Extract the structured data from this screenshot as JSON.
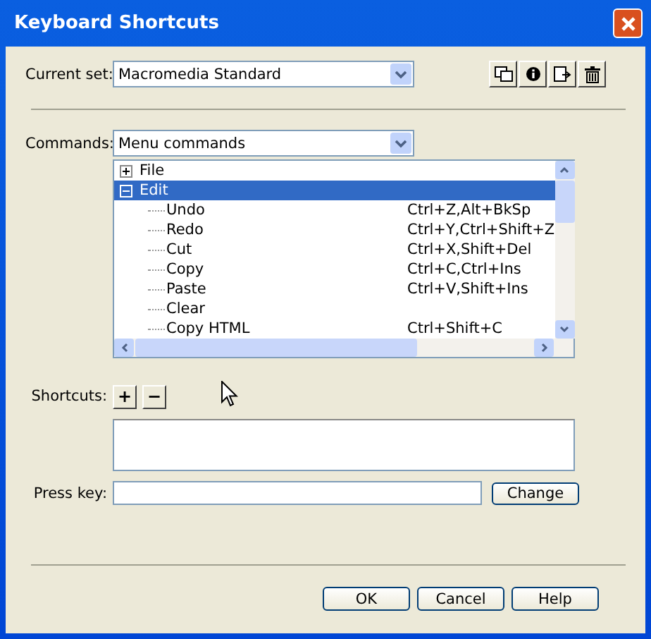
{
  "window": {
    "title": "Keyboard Shortcuts"
  },
  "current_set": {
    "label": "Current set:",
    "value": "Macromedia Standard"
  },
  "commands": {
    "label": "Commands:",
    "value": "Menu commands"
  },
  "tree": [
    {
      "name": "File",
      "expanded": false,
      "selected": false
    },
    {
      "name": "Edit",
      "expanded": true,
      "selected": true,
      "children": [
        {
          "name": "Undo",
          "shortcut": "Ctrl+Z,Alt+BkSp"
        },
        {
          "name": "Redo",
          "shortcut": "Ctrl+Y,Ctrl+Shift+Z"
        },
        {
          "name": "Cut",
          "shortcut": "Ctrl+X,Shift+Del"
        },
        {
          "name": "Copy",
          "shortcut": "Ctrl+C,Ctrl+Ins"
        },
        {
          "name": "Paste",
          "shortcut": "Ctrl+V,Shift+Ins"
        },
        {
          "name": "Clear"
        },
        {
          "name": "Copy HTML",
          "shortcut": "Ctrl+Shift+C"
        }
      ]
    }
  ],
  "shortcuts": {
    "label": "Shortcuts:",
    "add": "+",
    "remove": "−"
  },
  "press_key": {
    "label": "Press key:",
    "button": "Change"
  },
  "buttons": [
    "OK",
    "Cancel",
    "Help"
  ]
}
